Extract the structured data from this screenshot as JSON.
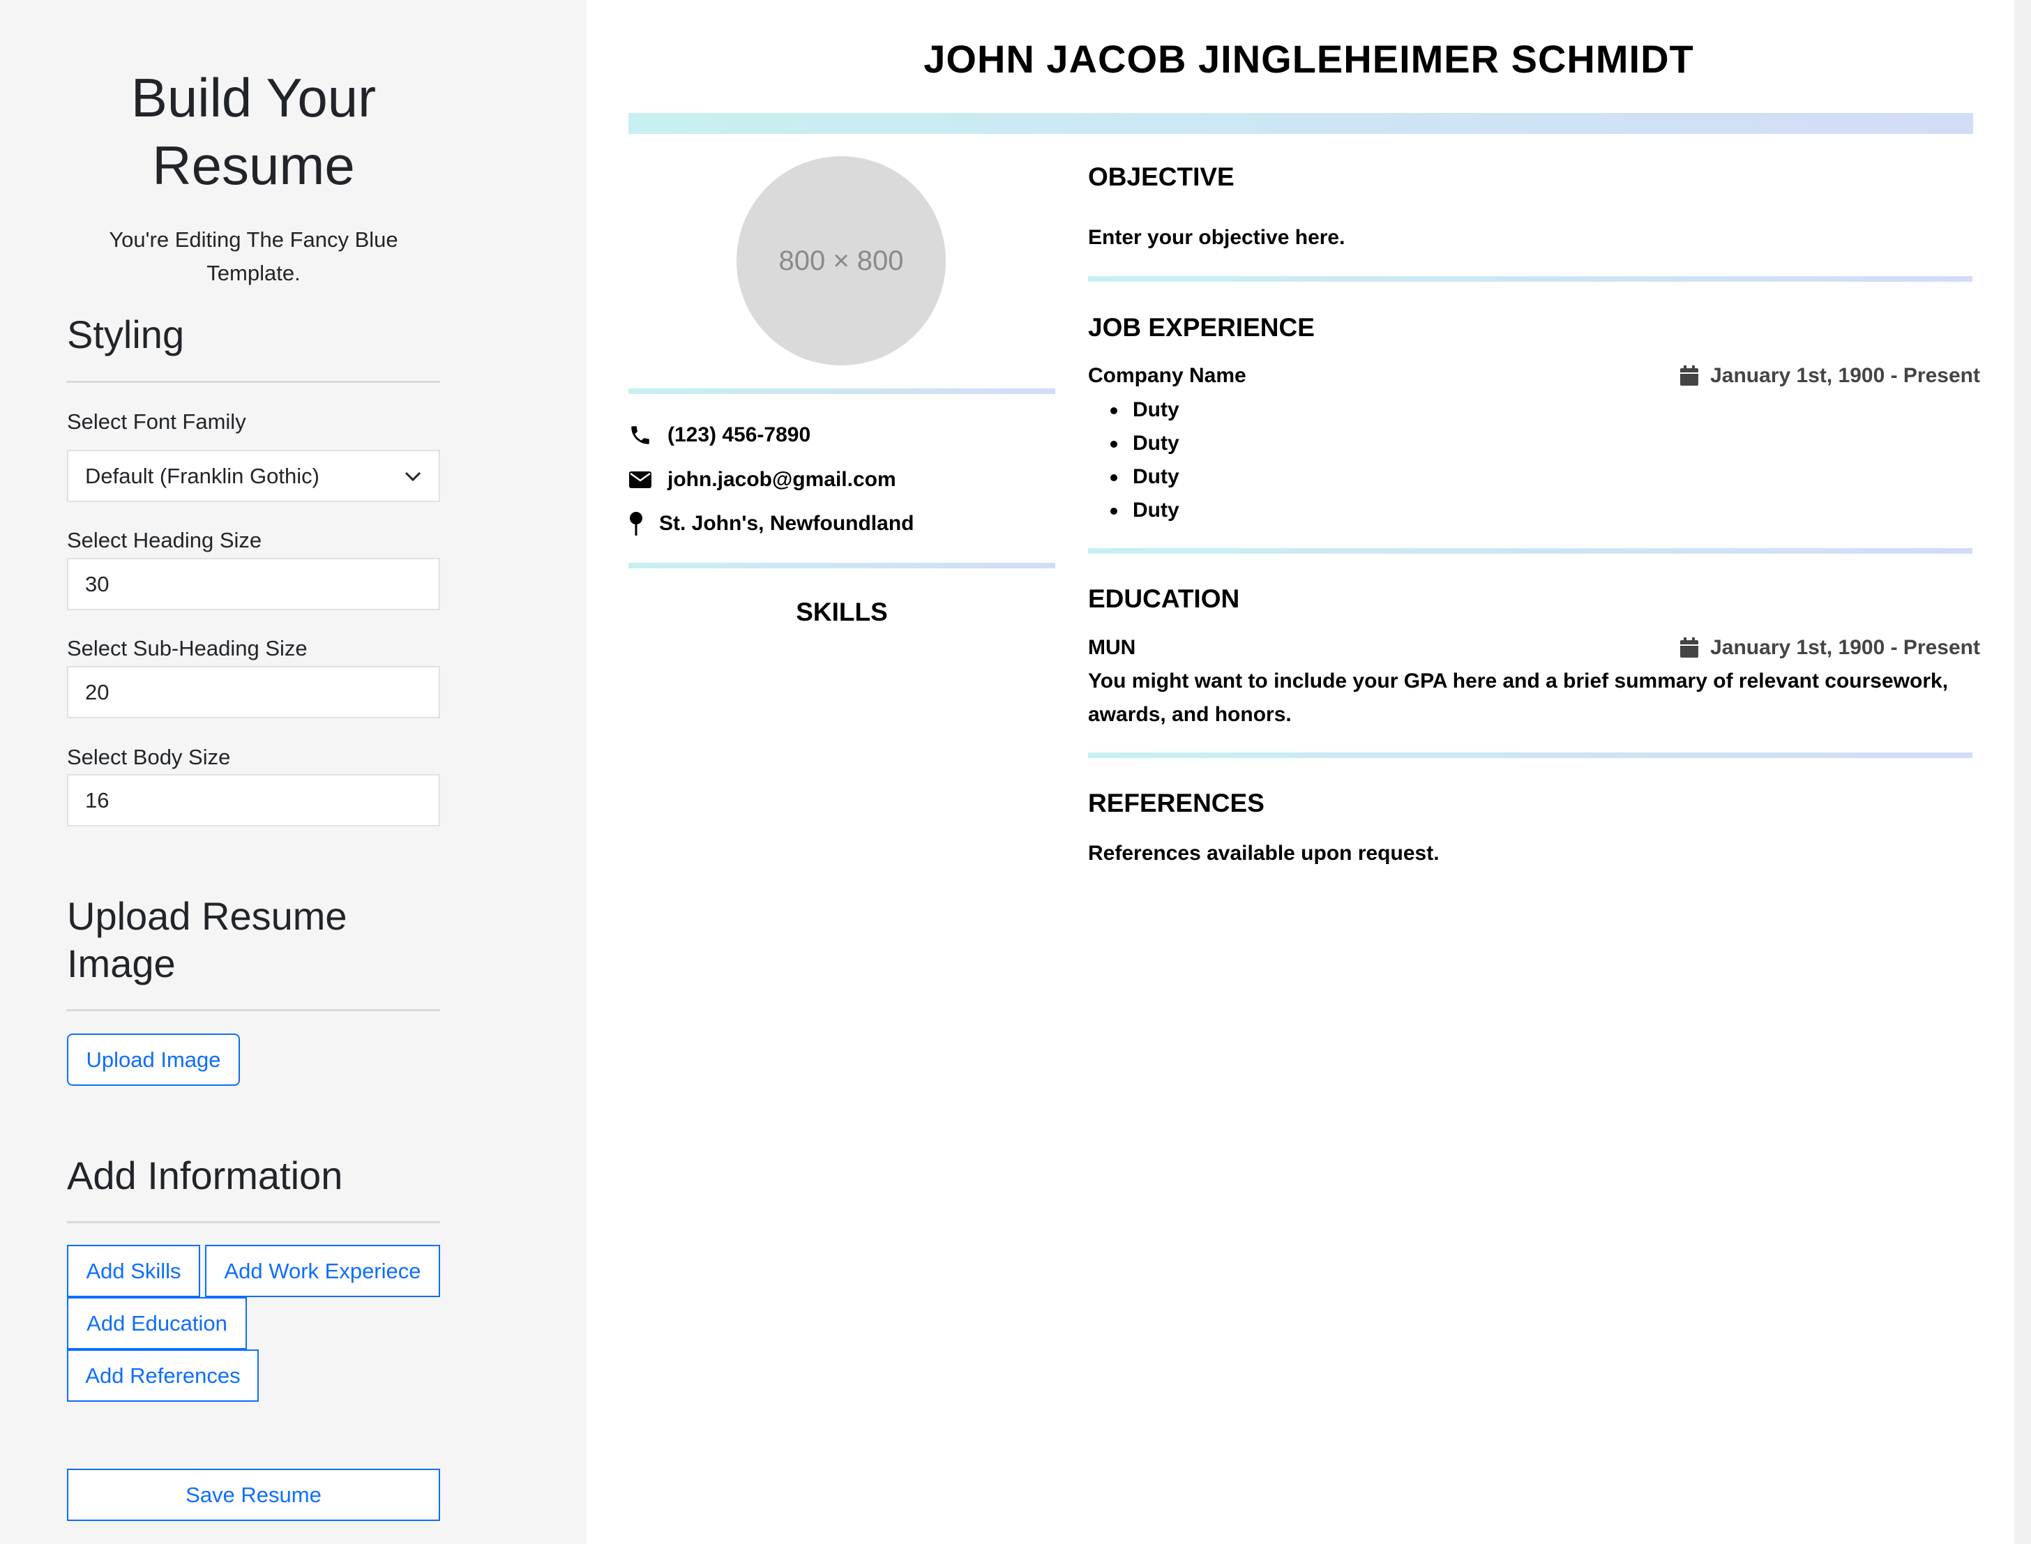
{
  "sidebar": {
    "title": "Build Your Resume",
    "subtitle": "You're Editing The Fancy Blue Template.",
    "styling": {
      "heading": "Styling",
      "font_family_label": "Select Font Family",
      "font_family_value": "Default (Franklin Gothic)",
      "heading_size_label": "Select Heading Size",
      "heading_size_value": "30",
      "subheading_size_label": "Select Sub-Heading Size",
      "subheading_size_value": "20",
      "body_size_label": "Select Body Size",
      "body_size_value": "16"
    },
    "upload": {
      "heading": "Upload Resume Image",
      "button": "Upload Image"
    },
    "add_info": {
      "heading": "Add Information",
      "add_skills": "Add Skills",
      "add_work": "Add Work Experiece",
      "add_education": "Add Education",
      "add_references": "Add References"
    },
    "save_button": "Save Resume"
  },
  "resume": {
    "name": "JOHN JACOB JINGLEHEIMER SCHMIDT",
    "photo_placeholder": "800 × 800",
    "contact": {
      "phone": "(123) 456-7890",
      "email": "john.jacob@gmail.com",
      "location": "St. John's, Newfoundland"
    },
    "skills_heading": "SKILLS",
    "objective": {
      "heading": "OBJECTIVE",
      "text": "Enter your objective here."
    },
    "job_experience": {
      "heading": "JOB EXPERIENCE",
      "company": "Company Name",
      "dates": "January 1st, 1900 - Present",
      "duties": [
        "Duty",
        "Duty",
        "Duty",
        "Duty"
      ]
    },
    "education": {
      "heading": "EDUCATION",
      "school": "MUN",
      "dates": "January 1st, 1900 - Present",
      "line1": "You might want to include your GPA here and a brief summary of relevant coursework,",
      "line2": "awards, and honors."
    },
    "references": {
      "heading": "REFERENCES",
      "text": "References available upon request."
    }
  },
  "colors": {
    "accent": "#0d6efd",
    "gradient_start": "#c8f0f2",
    "gradient_end": "#d3dcf6",
    "sidebar_bg": "#f5f5f5"
  },
  "icons": [
    "chevron-down-icon",
    "phone-icon",
    "envelope-icon",
    "map-pin-icon",
    "calendar-icon"
  ]
}
